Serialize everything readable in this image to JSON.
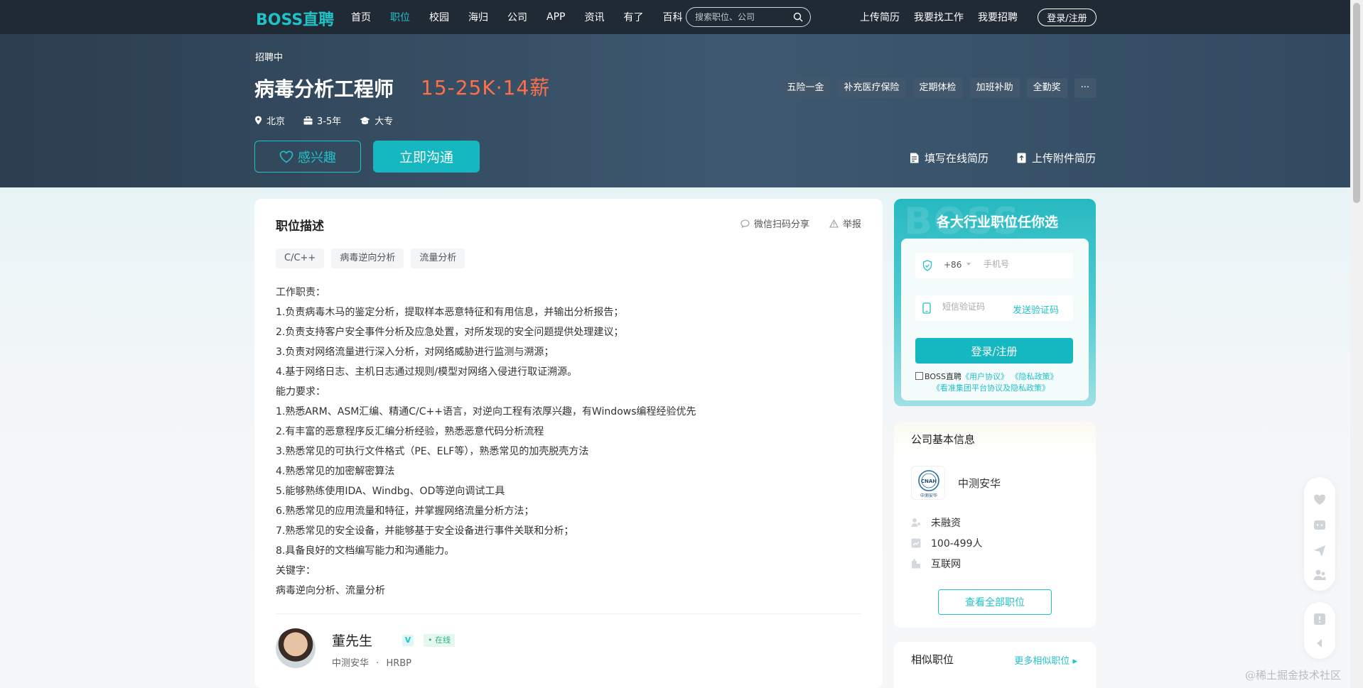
{
  "nav": {
    "logo": "BOSS直聘",
    "items": [
      "首页",
      "职位",
      "校园",
      "海归",
      "公司",
      "APP",
      "资讯",
      "有了",
      "百科"
    ],
    "active_index": 1,
    "search_placeholder": "搜索职位、公司",
    "right_links": [
      "上传简历",
      "我要找工作",
      "我要招聘"
    ],
    "login_label": "登录/注册"
  },
  "job": {
    "status": "招聘中",
    "title": "病毒分析工程师",
    "salary": "15-25K·14薪",
    "location": "北京",
    "experience": "3-5年",
    "education": "大专",
    "benefits": [
      "五险一金",
      "补充医疗保险",
      "定期体检",
      "加班补助",
      "全勤奖",
      "···"
    ],
    "interest_label": "感兴趣",
    "chat_label": "立即沟通",
    "fill_resume_label": "填写在线简历",
    "upload_resume_label": "上传附件简历"
  },
  "description": {
    "title": "职位描述",
    "share_label": "微信扫码分享",
    "report_label": "举报",
    "tags": [
      "C/C++",
      "病毒逆向分析",
      "流量分析"
    ],
    "lines": [
      "工作职责：",
      "1.负责病毒木马的鉴定分析，提取样本恶意特征和有用信息，并输出分析报告；",
      "2.负责支持客户安全事件分析及应急处置，对所发现的安全问题提供处理建议；",
      "3.负责对网络流量进行深入分析，对网络威胁进行监测与溯源；",
      "4.基于网络日志、主机日志通过规则/模型对网络入侵进行取证溯源。",
      "能力要求：",
      "1.熟悉ARM、ASM汇编、精通C/C++语言，对逆向工程有浓厚兴趣，有Windows编程经验优先",
      "2.有丰富的恶意程序反汇编分析经验，熟悉恶意代码分析流程",
      "3.熟悉常见的可执行文件格式（PE、ELF等），熟悉常见的加壳脱壳方法",
      "4.熟悉常见的加密解密算法",
      "5.能够熟练使用IDA、Windbg、OD等逆向调试工具",
      "6.熟悉常见的应用流量和特征，并掌握网络流量分析方法；",
      "7.熟悉常见的安全设备，并能够基于安全设备进行事件关联和分析；",
      "8.具备良好的文档编写能力和沟通能力。",
      "关键字：",
      "病毒逆向分析、流量分析"
    ]
  },
  "recruiter": {
    "name": "董先生",
    "verified_badge": "V",
    "status": "• 在线",
    "company": "中测安华",
    "separator": "·",
    "role": "HRBP"
  },
  "login_card": {
    "bg_word": "BOSS",
    "title": "各大行业职位任你选",
    "country_code": "+86",
    "phone_placeholder": "手机号",
    "code_placeholder": "短信验证码",
    "send_code_label": "发送验证码",
    "submit_label": "登录/注册",
    "agree_prefix": "BOSS直聘",
    "user_agreement": "《用户协议》",
    "privacy_policy": "《隐私政策》",
    "group_agreement": "《看准集团平台协议及隐私政策》"
  },
  "company": {
    "section_title": "公司基本信息",
    "name": "中测安华",
    "logo_text": "CNAH",
    "logo_sub": "中测安华",
    "financing": "未融资",
    "size": "100-499人",
    "industry": "互联网",
    "all_jobs_label": "查看全部职位"
  },
  "similar": {
    "title": "相似职位",
    "more_label": "更多相似职位 ▸"
  },
  "watermark": "@稀土掘金技术社区",
  "colors": {
    "brand": "#21c1c8",
    "salary": "#ff6f48",
    "nav_bg": "#202a35",
    "header_bg": "#34495e"
  }
}
